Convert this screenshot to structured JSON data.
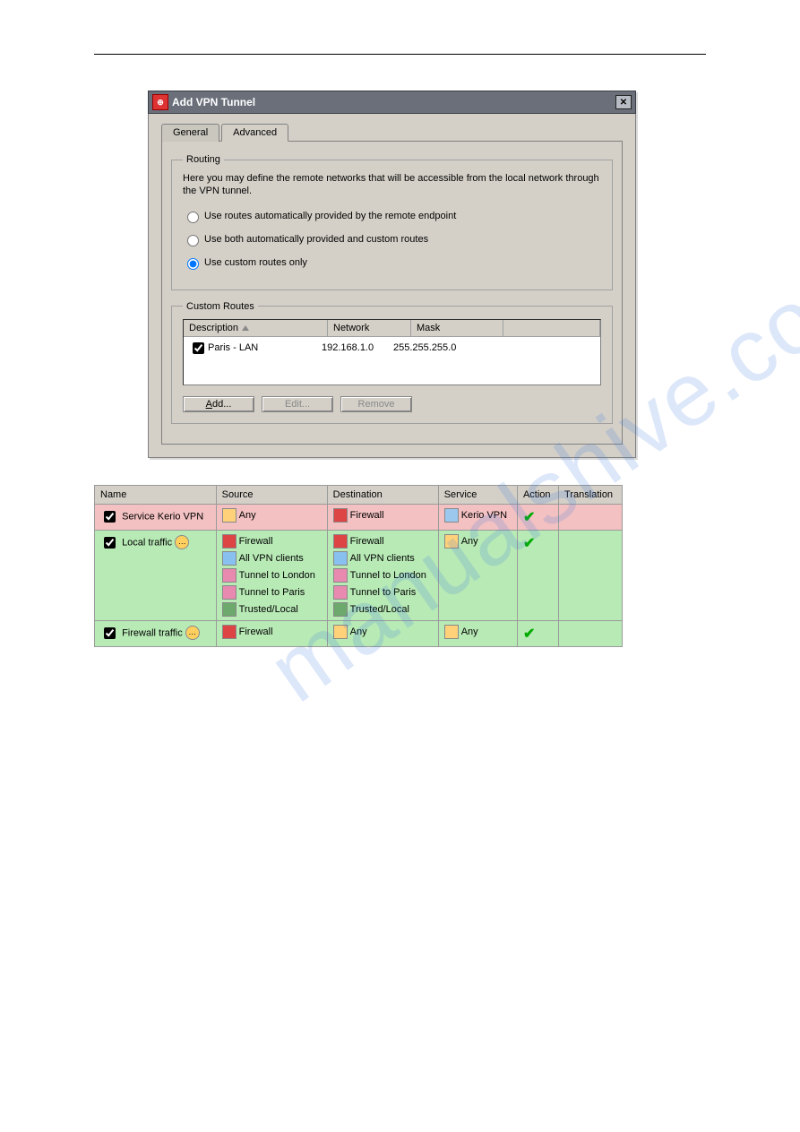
{
  "watermark": "manualshive.com",
  "dialog": {
    "title": "Add VPN Tunnel",
    "tabs": {
      "general": "General",
      "advanced": "Advanced"
    },
    "routing": {
      "legend": "Routing",
      "description": "Here you may define the remote networks that will be accessible from the local network through the VPN tunnel.",
      "opt_auto": "Use routes automatically provided by the remote endpoint",
      "opt_both": "Use both automatically provided and custom routes",
      "opt_custom": "Use custom routes only"
    },
    "custom_routes": {
      "legend": "Custom Routes",
      "headers": {
        "description": "Description",
        "network": "Network",
        "mask": "Mask"
      },
      "row": {
        "description": "Paris - LAN",
        "network": "192.168.1.0",
        "mask": "255.255.255.0"
      },
      "buttons": {
        "add": "Add...",
        "edit": "Edit...",
        "remove": "Remove"
      }
    }
  },
  "rules": {
    "headers": {
      "name": "Name",
      "source": "Source",
      "destination": "Destination",
      "service": "Service",
      "action": "Action",
      "translation": "Translation"
    },
    "rows": [
      {
        "name": "Service Kerio VPN",
        "source": [
          "Any"
        ],
        "destination": [
          "Firewall"
        ],
        "service": "Kerio VPN",
        "class": "pink",
        "balloon": false
      },
      {
        "name": "Local traffic",
        "source": [
          "Firewall",
          "All VPN clients",
          "Tunnel to London",
          "Tunnel to Paris",
          "Trusted/Local"
        ],
        "destination": [
          "Firewall",
          "All VPN clients",
          "Tunnel to London",
          "Tunnel to Paris",
          "Trusted/Local"
        ],
        "service": "Any",
        "class": "green",
        "balloon": true
      },
      {
        "name": "Firewall traffic",
        "source": [
          "Firewall"
        ],
        "destination": [
          "Any"
        ],
        "service": "Any",
        "class": "green",
        "balloon": true
      }
    ]
  }
}
